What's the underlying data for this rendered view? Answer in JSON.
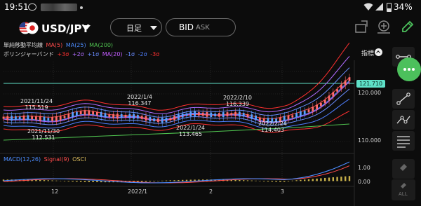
{
  "status_bar": {
    "time": "19:51",
    "battery": "34%"
  },
  "toolbar": {
    "symbol": "USD/JPY",
    "period": "日足",
    "price_type": "BID",
    "price_type_alt": "ASK"
  },
  "legend": {
    "ma_title": "単純移動平均線",
    "ma_items": [
      {
        "text": "MA(5)",
        "color": "#ff4b4b"
      },
      {
        "text": "MA(25)",
        "color": "#4d8dff"
      },
      {
        "text": "MA(200)",
        "color": "#4fc24f"
      }
    ],
    "bb_title": "ボリンジャーバンド",
    "bb_items": [
      {
        "text": "+3σ",
        "color": "#ff3030"
      },
      {
        "text": "+2σ",
        "color": "#b06cff"
      },
      {
        "text": "+1σ",
        "color": "#6a8cff"
      },
      {
        "text": "MA(20)",
        "color": "#c45cff"
      },
      {
        "text": "-1σ",
        "color": "#6a8cff"
      },
      {
        "text": "-2σ",
        "color": "#4f7fff"
      },
      {
        "text": "-3σ",
        "color": "#ff3030"
      }
    ],
    "macd_items": [
      {
        "text": "MACD(12,26)",
        "color": "#4d8dff"
      },
      {
        "text": "Signal(9)",
        "color": "#ff4b4b"
      },
      {
        "text": "OSCI",
        "color": "#e0c060"
      }
    ]
  },
  "indicator_button": "指標",
  "annotations": [
    {
      "date": "2021/11/24",
      "price": "115.519"
    },
    {
      "date": "2021/11/30",
      "price": "112.531"
    },
    {
      "date": "2022/1/4",
      "price": "116.347"
    },
    {
      "date": "2022/1/24",
      "price": "113.465"
    },
    {
      "date": "2022/2/10",
      "price": "116.339"
    },
    {
      "date": "2022/2/24",
      "price": "114.403"
    }
  ],
  "price_axis": {
    "current": "121.710",
    "ticks": [
      "120.000",
      "110.000"
    ]
  },
  "macd_axis": {
    "ticks": [
      "1.00",
      "0.00"
    ]
  },
  "date_axis": [
    "12",
    "2022/1",
    "2",
    "3"
  ],
  "side_buttons": {
    "delete_label": "",
    "delete_all_label": "ALL"
  },
  "colors": {
    "accent_green": "#4cc05c",
    "current_price_line": "#5fe0c8",
    "ma5": "#ff4b4b",
    "ma25": "#4d8dff",
    "ma200": "#4fc24f"
  }
}
